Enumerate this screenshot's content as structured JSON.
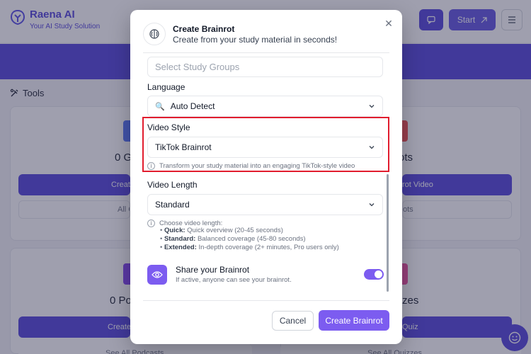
{
  "background": {
    "app_name": "Raena AI",
    "app_tagline": "Your AI Study Solution",
    "header_buttons": {
      "start": "Start"
    },
    "section_title": "Tools",
    "cards": {
      "top_left_count": "0 G",
      "top_right_count": "rots",
      "top_left_button": "Creat",
      "top_right_button": "rot Video",
      "top_left_link": "All C",
      "top_right_link": "ots",
      "bottom_left_count": "0 Po",
      "bottom_right_count": "zes",
      "bottom_left_button": "Create",
      "bottom_right_button": "Quiz",
      "bottom_left_link": "See All Podcasts",
      "bottom_right_link": "See All Quizzes"
    }
  },
  "modal": {
    "title": "Create Brainrot",
    "subtitle": "Create from your study material in seconds!",
    "study_groups_placeholder": "Select Study Groups",
    "language": {
      "label": "Language",
      "value": "Auto Detect"
    },
    "video_style": {
      "label": "Video Style",
      "value": "TikTok Brainrot",
      "helper": "Transform your study material into an engaging TikTok-style video"
    },
    "video_length": {
      "label": "Video Length",
      "value": "Standard",
      "helper_title": "Choose video length:",
      "options": [
        {
          "name": "Quick:",
          "desc": "Quick overview (20-45 seconds)"
        },
        {
          "name": "Standard:",
          "desc": "Balanced coverage (45-80 seconds)"
        },
        {
          "name": "Extended:",
          "desc": "In-depth coverage (2+ minutes, Pro users only)"
        }
      ]
    },
    "share": {
      "title": "Share your Brainrot",
      "description": "If active, anyone can see your brainrot.",
      "enabled": true
    },
    "buttons": {
      "cancel": "Cancel",
      "create": "Create Brainrot"
    }
  },
  "colors": {
    "accent": "#7c5cf0",
    "brand": "#4c3dd8",
    "highlight": "#e11d2e"
  }
}
